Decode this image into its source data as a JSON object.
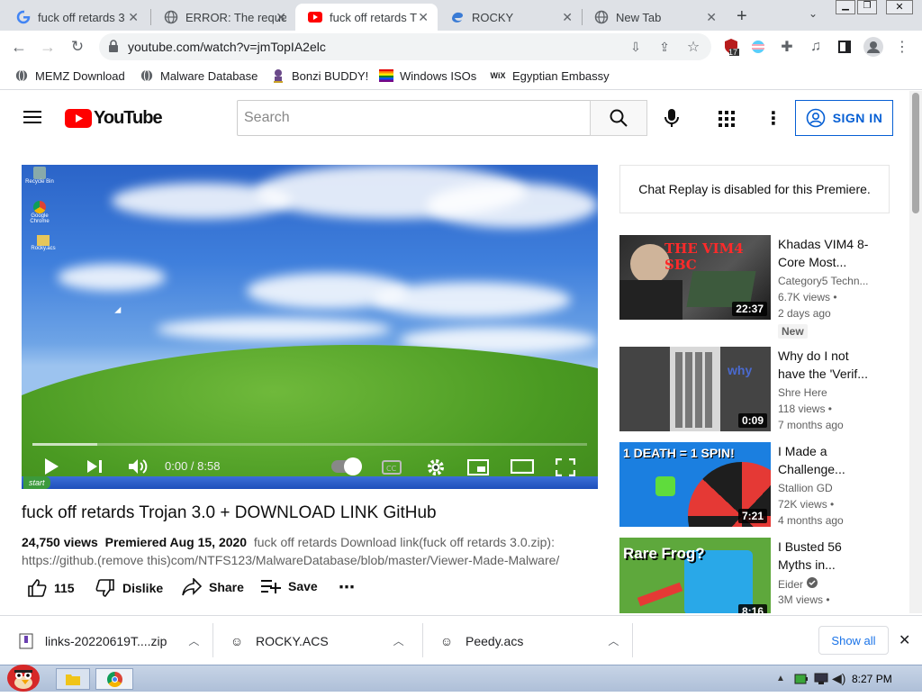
{
  "browser": {
    "tabs": [
      {
        "title": "fuck off retards 3",
        "icon": "google-g-icon"
      },
      {
        "title": "ERROR: The reque",
        "icon": "globe-icon"
      },
      {
        "title": "fuck off retards T",
        "icon": "youtube-icon",
        "active": true
      },
      {
        "title": "ROCKY",
        "icon": "edge-icon"
      },
      {
        "title": "New Tab",
        "icon": "chrome-icon"
      }
    ],
    "url": "youtube.com/watch?v=jmTopIA2elc",
    "extension_badge": "17",
    "bookmarks": [
      "MEMZ Download",
      "Malware Database",
      "Bonzi BUDDY!",
      "Windows ISOs",
      "Egyptian Embassy"
    ]
  },
  "youtube": {
    "logo_text": "YouTube",
    "search_placeholder": "Search",
    "signin_label": "SIGN IN",
    "player": {
      "time": "0:00 / 8:58",
      "progress_fraction": 0.0,
      "desktop_icons": [
        "Recycle Bin",
        "Google Chrome",
        "Rocky.acs"
      ],
      "xp_start": "start"
    },
    "video": {
      "title": "fuck off retards Trojan 3.0 + DOWNLOAD LINK GitHub",
      "views": "24,750 views",
      "premiered": "Premiered Aug 15, 2020",
      "description_line1": "fuck off retards Download link(fuck off retards 3.0.zip):",
      "description_line2": "https://github.(remove this)com/NTFS123/MalwareDatabase/blob/master/Viewer-Made-Malware/",
      "likes": "115",
      "dislike_label": "Dislike",
      "share_label": "Share",
      "save_label": "Save"
    },
    "chat_replay": "Chat Replay is disabled for this Premiere.",
    "recommendations": [
      {
        "title": "Khadas VIM4 8-Core Most...",
        "channel": "Category5 Techn...",
        "views": "6.7K views •",
        "age": "2 days ago",
        "duration": "22:37",
        "badge": "New",
        "thumb_text": "THE VIM4 SBC"
      },
      {
        "title": "Why do I not have the 'Verif...",
        "channel": "Shre Here",
        "views": "118 views •",
        "age": "7 months ago",
        "duration": "0:09",
        "thumb_text": "why"
      },
      {
        "title": "I Made a Challenge...",
        "channel": "Stallion GD",
        "views": "72K views •",
        "age": "4 months ago",
        "duration": "7:21",
        "thumb_text": "1 DEATH = 1 SPIN!"
      },
      {
        "title": "I Busted 56 Myths in...",
        "channel": "Eider",
        "views": "3M views •",
        "age": "",
        "duration": "8:16",
        "thumb_text": "Rare Frog?"
      }
    ]
  },
  "downloads": [
    {
      "name": "links-20220619T....zip"
    },
    {
      "name": "ROCKY.ACS"
    },
    {
      "name": "Peedy.acs"
    }
  ],
  "downloads_show_all": "Show all",
  "taskbar": {
    "clock": "8:27 PM"
  },
  "colors": {
    "youtube_red": "#ff0000",
    "link_blue": "#065fd4",
    "chrome_tabstrip": "#dee1e6"
  }
}
